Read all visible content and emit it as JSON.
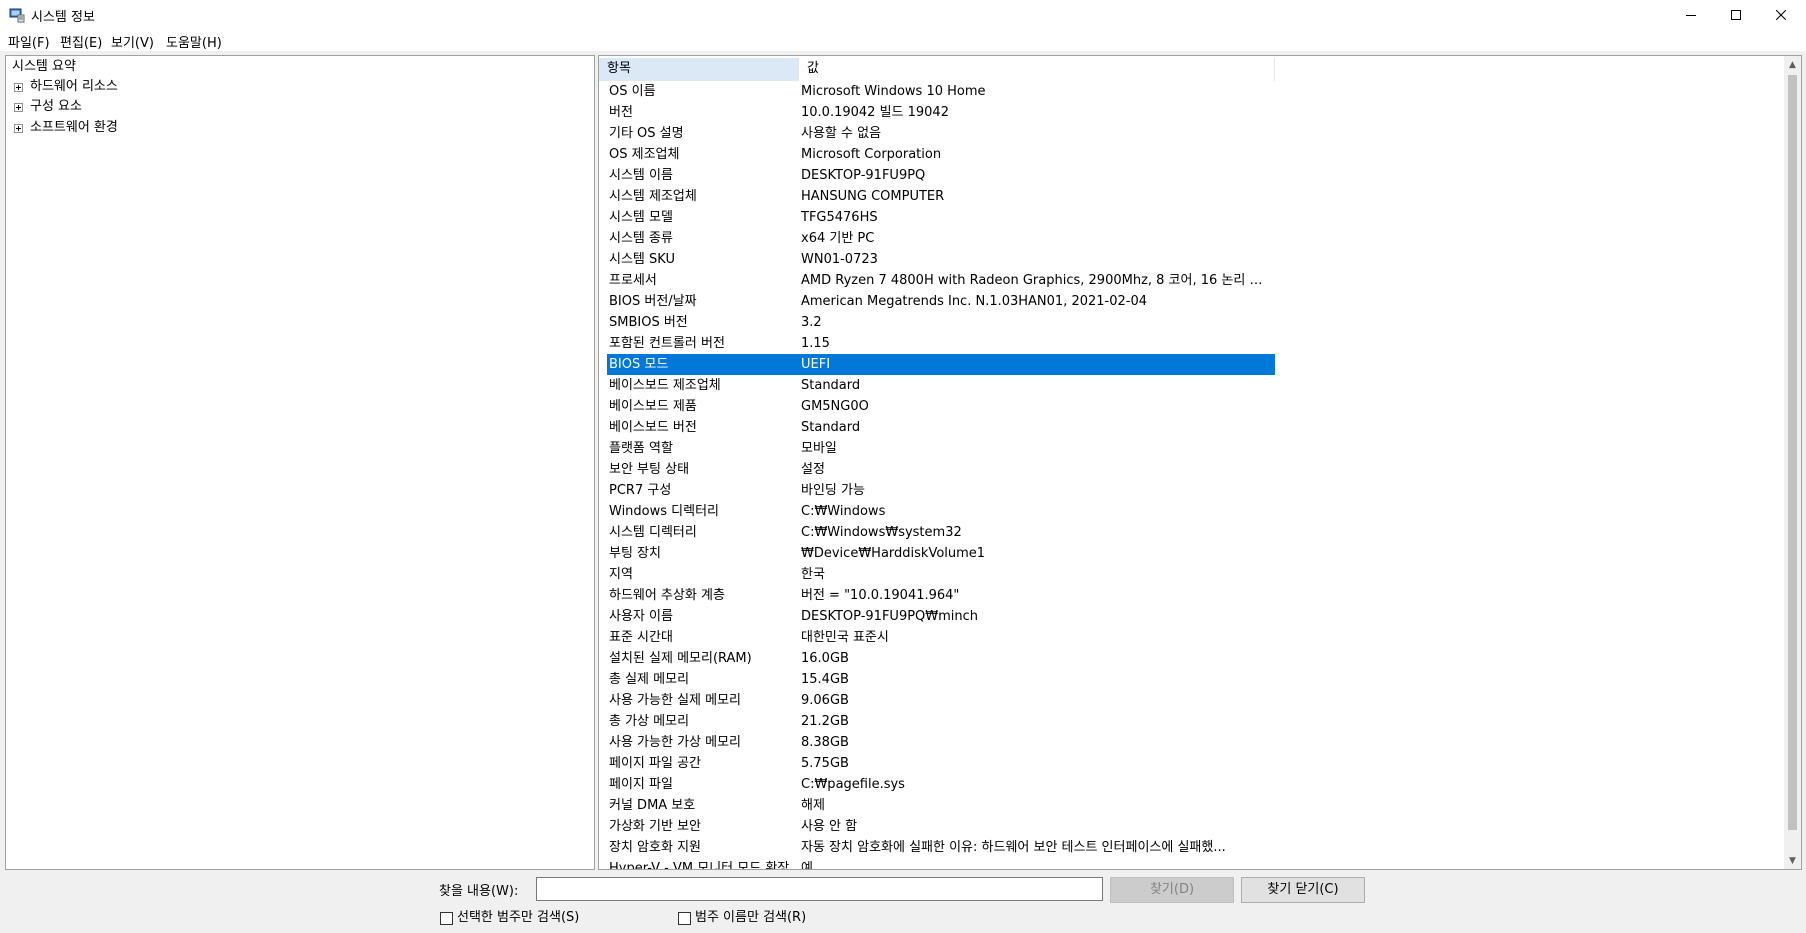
{
  "window": {
    "title": "시스템 정보"
  },
  "menu": [
    "파일(F)",
    "편집(E)",
    "보기(V)",
    "도움말(H)"
  ],
  "tree": {
    "root": "시스템 요약",
    "children": [
      "하드웨어 리소스",
      "구성 요소",
      "소프트웨어 환경"
    ]
  },
  "list": {
    "header_item": "항목",
    "header_value": "값",
    "selected_item": "BIOS 모드",
    "rows": [
      [
        "OS 이름",
        "Microsoft Windows 10 Home"
      ],
      [
        "버전",
        "10.0.19042 빌드 19042"
      ],
      [
        "기타 OS 설명",
        "사용할 수 없음"
      ],
      [
        "OS 제조업체",
        "Microsoft Corporation"
      ],
      [
        "시스템 이름",
        "DESKTOP-91FU9PQ"
      ],
      [
        "시스템 제조업체",
        "HANSUNG COMPUTER"
      ],
      [
        "시스템 모델",
        "TFG5476HS"
      ],
      [
        "시스템 종류",
        "x64 기반 PC"
      ],
      [
        "시스템 SKU",
        "WN01-0723"
      ],
      [
        "프로세서",
        "AMD Ryzen 7 4800H with Radeon Graphics, 2900Mhz, 8 코어, 16 논리 프로..."
      ],
      [
        "BIOS 버전/날짜",
        "American Megatrends Inc. N.1.03HAN01, 2021-02-04"
      ],
      [
        "SMBIOS 버전",
        "3.2"
      ],
      [
        "포함된 컨트롤러 버전",
        "1.15"
      ],
      [
        "BIOS 모드",
        "UEFI"
      ],
      [
        "베이스보드 제조업체",
        "Standard"
      ],
      [
        "베이스보드 제품",
        "GM5NG0O"
      ],
      [
        "베이스보드 버전",
        "Standard"
      ],
      [
        "플랫폼 역할",
        "모바일"
      ],
      [
        "보안 부팅 상태",
        "설정"
      ],
      [
        "PCR7 구성",
        "바인딩 가능"
      ],
      [
        "Windows 디렉터리",
        "C:₩Windows"
      ],
      [
        "시스템 디렉터리",
        "C:₩Windows₩system32"
      ],
      [
        "부팅 장치",
        "₩Device₩HarddiskVolume1"
      ],
      [
        "지역",
        "한국"
      ],
      [
        "하드웨어 추상화 계층",
        "버전 = \"10.0.19041.964\""
      ],
      [
        "사용자 이름",
        "DESKTOP-91FU9PQ₩minch"
      ],
      [
        "표준 시간대",
        "대한민국 표준시"
      ],
      [
        "설치된 실제 메모리(RAM)",
        "16.0GB"
      ],
      [
        "총 실제 메모리",
        "15.4GB"
      ],
      [
        "사용 가능한 실제 메모리",
        "9.06GB"
      ],
      [
        "총 가상 메모리",
        "21.2GB"
      ],
      [
        "사용 가능한 가상 메모리",
        "8.38GB"
      ],
      [
        "페이지 파일 공간",
        "5.75GB"
      ],
      [
        "페이지 파일",
        "C:₩pagefile.sys"
      ],
      [
        "커널 DMA 보호",
        "해제"
      ],
      [
        "가상화 기반 보안",
        "사용 안 함"
      ],
      [
        "장치 암호화 지원",
        "자동 장치 암호화에 실패한 이유: 하드웨어 보안 테스트 인터페이스에 실패했..."
      ],
      [
        "Hyper-V - VM 모니터 모드 확장",
        "예"
      ]
    ]
  },
  "find": {
    "label": "찾을 내용(W):",
    "input_value": "",
    "find_button": "찾기(D)",
    "close_button": "찾기 닫기(C)",
    "check_selected_category": "선택한 범주만 검색(S)",
    "check_category_names": "범주 이름만 검색(R)"
  },
  "colors": {
    "selection": "#0078d7",
    "header_highlight": "#dbe9f7"
  }
}
